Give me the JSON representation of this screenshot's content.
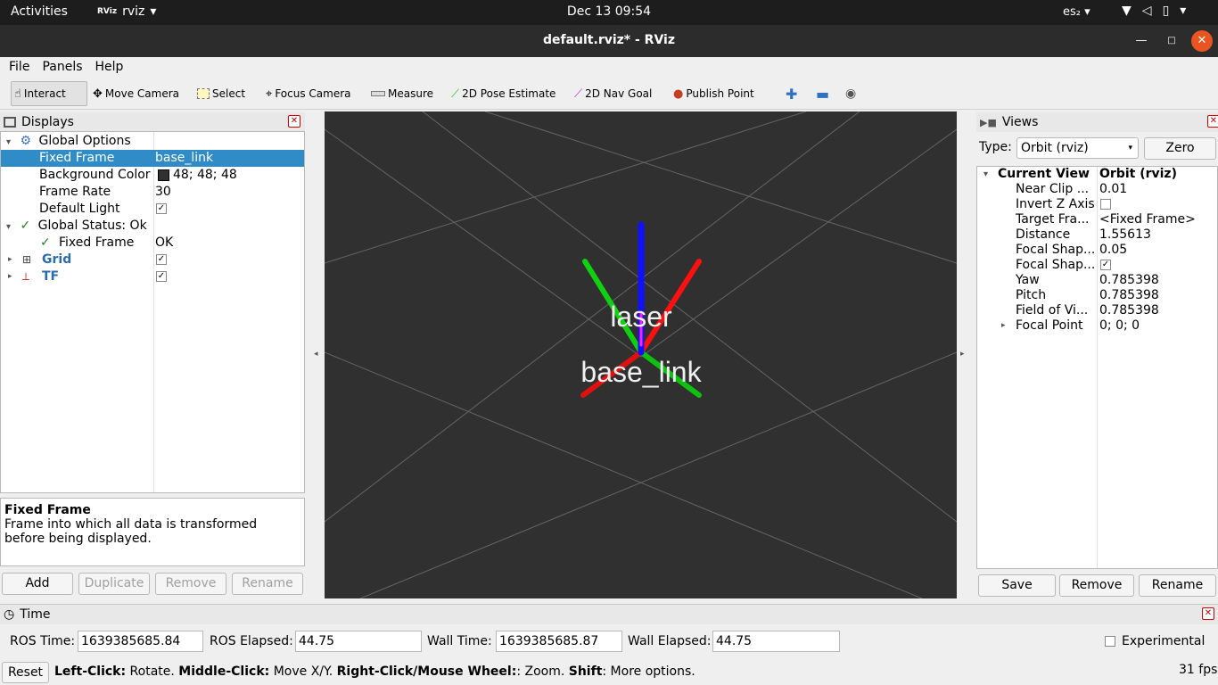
{
  "topbar": {
    "activities": "Activities",
    "app_name": "rviz",
    "app_icon": "RViz",
    "clock": "Dec 13  09:54",
    "keyboard": "es₂"
  },
  "window": {
    "title": "default.rviz* - RViz"
  },
  "menu": [
    "File",
    "Panels",
    "Help"
  ],
  "toolbar": {
    "interact": "Interact",
    "move_camera": "Move Camera",
    "select": "Select",
    "focus_camera": "Focus Camera",
    "measure": "Measure",
    "pose_estimate": "2D Pose Estimate",
    "nav_goal": "2D Nav Goal",
    "publish_point": "Publish Point"
  },
  "displays": {
    "title": "Displays",
    "rows": {
      "global_options": "Global Options",
      "fixed_frame_label": "Fixed Frame",
      "fixed_frame_value": "base_link",
      "bg_color_label": "Background Color",
      "bg_color_value": "48; 48; 48",
      "frame_rate_label": "Frame Rate",
      "frame_rate_value": "30",
      "default_light_label": "Default Light",
      "global_status": "Global Status: Ok",
      "status_fixed_frame": "Fixed Frame",
      "status_value": "OK",
      "grid": "Grid",
      "tf": "TF"
    },
    "help_title": "Fixed Frame",
    "help_text": "Frame into which all data is transformed before being displayed.",
    "buttons": {
      "add": "Add",
      "duplicate": "Duplicate",
      "remove": "Remove",
      "rename": "Rename"
    }
  },
  "scene": {
    "laser_label": "laser",
    "base_label": "base_link"
  },
  "views": {
    "title": "Views",
    "type_label": "Type:",
    "type_value": "Orbit (rviz)",
    "zero": "Zero",
    "current_view": "Current View",
    "current_view_value": "Orbit (rviz)",
    "props": [
      {
        "k": "Near Clip ...",
        "v": "0.01"
      },
      {
        "k": "Invert Z Axis",
        "v": ""
      },
      {
        "k": "Target Fra...",
        "v": "<Fixed Frame>"
      },
      {
        "k": "Distance",
        "v": "1.55613"
      },
      {
        "k": "Focal Shap...",
        "v": "0.05"
      },
      {
        "k": "Focal Shap...",
        "v": ""
      },
      {
        "k": "Yaw",
        "v": "0.785398"
      },
      {
        "k": "Pitch",
        "v": "0.785398"
      },
      {
        "k": "Field of Vi...",
        "v": "0.785398"
      },
      {
        "k": "Focal Point",
        "v": "0; 0; 0"
      }
    ],
    "buttons": {
      "save": "Save",
      "remove": "Remove",
      "rename": "Rename"
    }
  },
  "time": {
    "title": "Time",
    "ros_time_label": "ROS Time:",
    "ros_time": "1639385685.84",
    "ros_elapsed_label": "ROS Elapsed:",
    "ros_elapsed": "44.75",
    "wall_time_label": "Wall Time:",
    "wall_time": "1639385685.87",
    "wall_elapsed_label": "Wall Elapsed:",
    "wall_elapsed": "44.75",
    "experimental": "Experimental"
  },
  "status": {
    "reset": "Reset",
    "hint_b1": "Left-Click:",
    "hint_t1": " Rotate. ",
    "hint_b2": "Middle-Click:",
    "hint_t2": " Move X/Y. ",
    "hint_b3": "Right-Click/Mouse Wheel:",
    "hint_t3": ": Zoom. ",
    "hint_b4": "Shift",
    "hint_t4": ": More options.",
    "fps": "31 fps"
  },
  "colors": {
    "accent_select": "#308cc6",
    "close": "#e95420",
    "viewport_bg": "#303030"
  }
}
